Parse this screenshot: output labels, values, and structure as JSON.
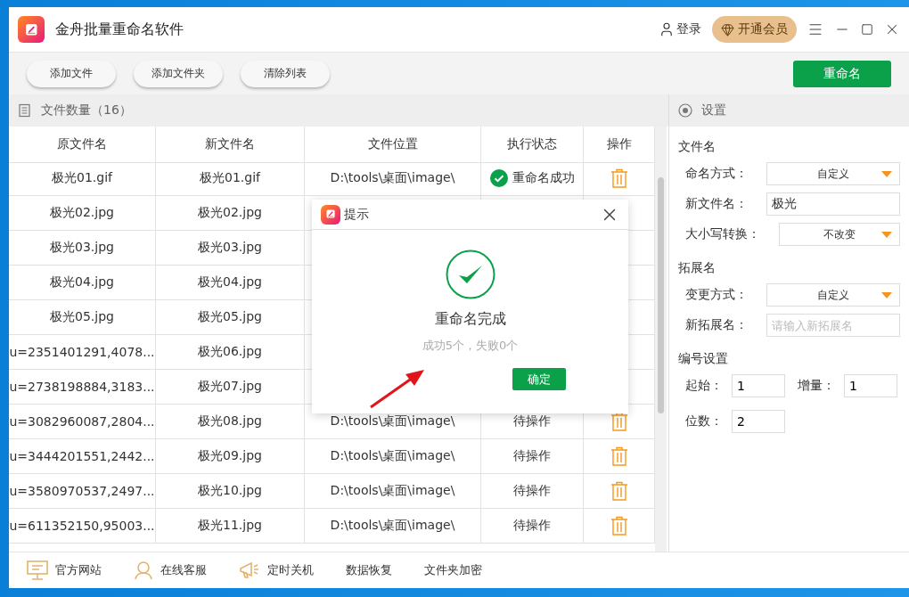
{
  "window": {
    "title": "金舟批量重命名软件",
    "login": "登录",
    "vip": "开通会员"
  },
  "toolbar": {
    "buttons": [
      "添加文件",
      "添加文件夹",
      "清除列表"
    ],
    "primary": "重命名"
  },
  "file_list": {
    "title": "文件数量（16）",
    "columns": [
      "原文件名",
      "新文件名",
      "文件位置",
      "执行状态",
      "操作"
    ],
    "rows": [
      {
        "original": "极光01.gif",
        "new": "极光01.gif",
        "location": "D:\\tools\\桌面\\image\\",
        "status": {
          "kind": "success",
          "text": "重命名成功"
        }
      },
      {
        "original": "极光02.jpg",
        "new": "极光02.jpg"
      },
      {
        "original": "极光03.jpg",
        "new": "极光03.jpg"
      },
      {
        "original": "极光04.jpg",
        "new": "极光04.jpg"
      },
      {
        "original": "极光05.jpg",
        "new": "极光05.jpg"
      },
      {
        "original": "u=2351401291,4078...",
        "new": "极光06.jpg"
      },
      {
        "original": "u=2738198884,3183...",
        "new": "极光07.jpg"
      },
      {
        "original": "u=3082960087,2804...",
        "new": "极光08.jpg",
        "location": "D:\\tools\\桌面\\image\\",
        "status": {
          "kind": "pending",
          "text": "待操作"
        }
      },
      {
        "original": "u=3444201551,2442...",
        "new": "极光09.jpg",
        "location": "D:\\tools\\桌面\\image\\",
        "status": {
          "kind": "pending",
          "text": "待操作"
        }
      },
      {
        "original": "u=3580970537,2497...",
        "new": "极光10.jpg",
        "location": "D:\\tools\\桌面\\image\\",
        "status": {
          "kind": "pending",
          "text": "待操作"
        }
      },
      {
        "original": "u=611352150,95003...",
        "new": "极光11.jpg",
        "location": "D:\\tools\\桌面\\image\\",
        "status": {
          "kind": "pending",
          "text": "待操作"
        }
      }
    ]
  },
  "settings": {
    "title": "设置",
    "sections": [
      {
        "title": "文件名",
        "fields": [
          {
            "kind": "select",
            "label": "命名方式：",
            "value": "自定义"
          },
          {
            "kind": "input",
            "label": "新文件名：",
            "value": "极光"
          },
          {
            "kind": "select",
            "label": "大小写转换：",
            "value": "不改变"
          }
        ]
      },
      {
        "title": "拓展名",
        "fields": [
          {
            "kind": "select",
            "label": "变更方式：",
            "value": "自定义"
          },
          {
            "kind": "input",
            "label": "新拓展名：",
            "placeholder": "请输入新拓展名"
          }
        ]
      },
      {
        "title": "编号设置",
        "fields": [
          {
            "kind": "number",
            "label": "起始：",
            "value": "1"
          },
          {
            "kind": "number",
            "label": "增量：",
            "value": "1"
          },
          {
            "kind": "number",
            "label": "位数：",
            "value": "2"
          }
        ]
      }
    ]
  },
  "dialog": {
    "title": "提示",
    "heading": "重命名完成",
    "summary": "成功5个，失败0个",
    "button": "确定"
  },
  "footer": {
    "links": [
      {
        "kind": "monitor",
        "label": "官方网站"
      },
      {
        "kind": "person",
        "label": "在线客服"
      },
      {
        "kind": "megaphone",
        "label": "定时关机"
      },
      {
        "kind": "text",
        "label": "数据恢复"
      },
      {
        "kind": "text",
        "label": "文件夹加密"
      }
    ]
  }
}
